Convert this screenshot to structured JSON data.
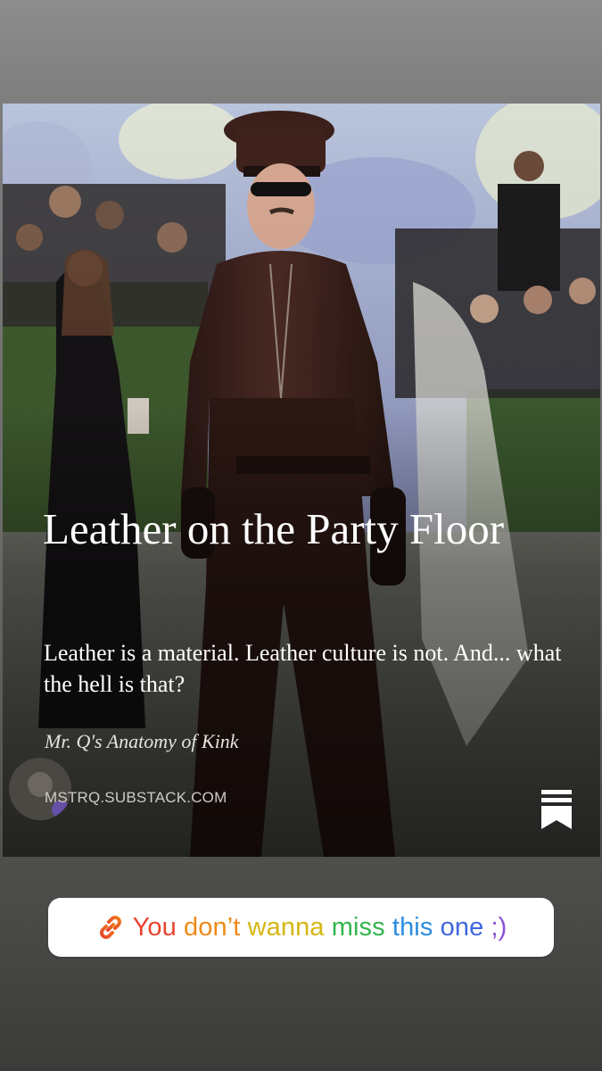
{
  "card": {
    "title": "Leather on the Party Floor",
    "subtitle": "Leather is a material. Leather culture is not. And... what the hell is that?",
    "publication": "Mr. Q's Anatomy of Kink",
    "domain": "MSTRQ.SUBSTACK.COM",
    "icons": {
      "bookmark": "substack-bookmark-icon",
      "logo": "publication-logo"
    }
  },
  "sticker": {
    "icon": "link-icon",
    "words": [
      {
        "text": "You",
        "color": "#e8432f"
      },
      {
        "text": "don’t",
        "color": "#ef8a1a"
      },
      {
        "text": "wanna",
        "color": "#d6b611"
      },
      {
        "text": "miss",
        "color": "#33b54b"
      },
      {
        "text": "this",
        "color": "#2b8de0"
      },
      {
        "text": "one",
        "color": "#3f66dc"
      },
      {
        "text": ";)",
        "color": "#8a4fd6"
      }
    ]
  },
  "colors": {
    "background_top": "#8d8d8d",
    "background_bottom": "#3b3b39",
    "card_text": "#ffffff",
    "sticker_background": "#ffffff"
  }
}
